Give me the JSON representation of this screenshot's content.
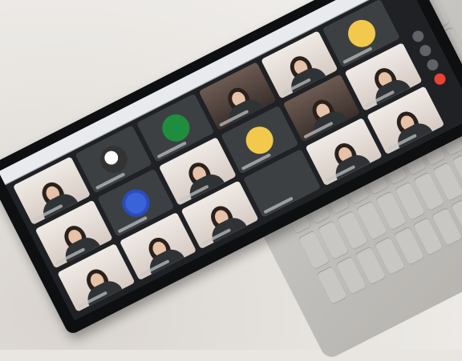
{
  "scene": {
    "description_tag": "laptop-video-call-photo",
    "colors": {
      "desk": "#e9e6e2",
      "bezel": "#0d0f11",
      "meeting_bg": "#1f2124",
      "tile_bg": "#3c4043",
      "laptop_body": "#c9c7c3",
      "end_call": "#ea4335"
    }
  },
  "meeting": {
    "tiles": [
      {
        "kind": "video",
        "tone": "light"
      },
      {
        "kind": "avatar",
        "avatar": "av-photo"
      },
      {
        "kind": "avatar",
        "avatar": "av-green"
      },
      {
        "kind": "video",
        "tone": "dark"
      },
      {
        "kind": "video",
        "tone": "light"
      },
      {
        "kind": "avatar",
        "avatar": "av-yellow"
      },
      {
        "kind": "video",
        "tone": "light"
      },
      {
        "kind": "avatar",
        "avatar": "av-blue"
      },
      {
        "kind": "video",
        "tone": "light"
      },
      {
        "kind": "avatar",
        "avatar": "av-yellow"
      },
      {
        "kind": "video",
        "tone": "dark"
      },
      {
        "kind": "video",
        "tone": "light"
      },
      {
        "kind": "video",
        "tone": "light"
      },
      {
        "kind": "video",
        "tone": "light"
      },
      {
        "kind": "video",
        "tone": "light"
      },
      {
        "kind": "blank"
      },
      {
        "kind": "video",
        "tone": "light"
      },
      {
        "kind": "video",
        "tone": "light"
      }
    ],
    "controls": [
      "mic-icon",
      "camera-icon",
      "present-icon",
      "end-call-icon"
    ]
  }
}
